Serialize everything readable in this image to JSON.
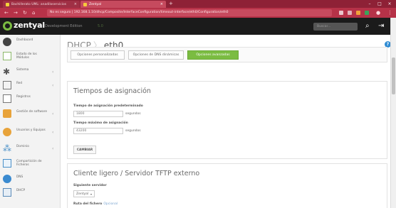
{
  "browser": {
    "tabs": [
      {
        "label": "Bachillerato UML: anadiloservicios",
        "close": "×"
      },
      {
        "label": "Zentyal",
        "close": "×"
      }
    ],
    "new_tab": "+",
    "url": "No es seguro | 192.168.1.10/dhcp/Composite/InterfaceConfiguration/timeout-interface/eth0/Configuration/eth0",
    "window_controls": [
      "–",
      "□",
      "×"
    ]
  },
  "header": {
    "brand": "zentyal",
    "edition": "Development Edition",
    "version": "5.0",
    "search_placeholder": "Buscar..."
  },
  "sidebar": {
    "items": [
      {
        "label": "Dashboard",
        "icon": "dashboard-icon",
        "color": "#444444",
        "has_children": false
      },
      {
        "label": "Estado de los Módulos",
        "icon": "module-status-icon",
        "color": "#8cb86a",
        "has_children": false
      },
      {
        "label": "Sistema",
        "icon": "gear-icon",
        "color": "#555555",
        "has_children": true
      },
      {
        "label": "Red",
        "icon": "network-icon",
        "color": "#777777",
        "has_children": true
      },
      {
        "label": "Registros",
        "icon": "logs-icon",
        "color": "#777777",
        "has_children": false
      },
      {
        "label": "Gestión de software",
        "icon": "software-box-icon",
        "color": "#e8a33a",
        "has_children": true
      },
      {
        "label": "Usuarios y Equipos",
        "icon": "users-icon",
        "color": "#e8a33a",
        "has_children": true
      },
      {
        "label": "Dominio",
        "icon": "domain-icon",
        "color": "#4a90c8",
        "has_children": true
      },
      {
        "label": "Compartición de Ficheros",
        "icon": "file-share-icon",
        "color": "#4a90c8",
        "has_children": false
      },
      {
        "label": "DNS",
        "icon": "dns-icon",
        "color": "#3a8ad0",
        "has_children": false
      },
      {
        "label": "DHCP",
        "icon": "dhcp-icon",
        "color": "#5a8ab8",
        "has_children": false
      }
    ]
  },
  "breadcrumb": {
    "parent": "DHCP",
    "separator": "〉",
    "current": "eth0"
  },
  "tabs": [
    {
      "label": "Opciones personalizadas",
      "active": false
    },
    {
      "label": "Opciones de DNS dinámicas",
      "active": false
    },
    {
      "label": "Opciones avanzadas",
      "active": true
    }
  ],
  "lease_section": {
    "title": "Tiempos de asignación",
    "default_label": "Tiempo de asignación predeterminado",
    "default_value": "1800",
    "default_unit": "segundos",
    "max_label": "Tiempo máximo de asignación",
    "max_value": "43200",
    "max_unit": "segundos",
    "button": "CAMBIAR"
  },
  "tftp_section": {
    "title": "Cliente ligero / Servidor TFTP externo",
    "next_server_label": "Siguiente servidor",
    "next_server_value": "Zentyal",
    "path_label": "Ruta del fichero",
    "path_optional": "Opcional"
  },
  "colors": {
    "tabstrip": "#8e2136",
    "addressbar": "#b63248",
    "accent_green": "#7bbc42",
    "header_bg": "#1b1b1b",
    "help_blue": "#2e8bd3"
  }
}
